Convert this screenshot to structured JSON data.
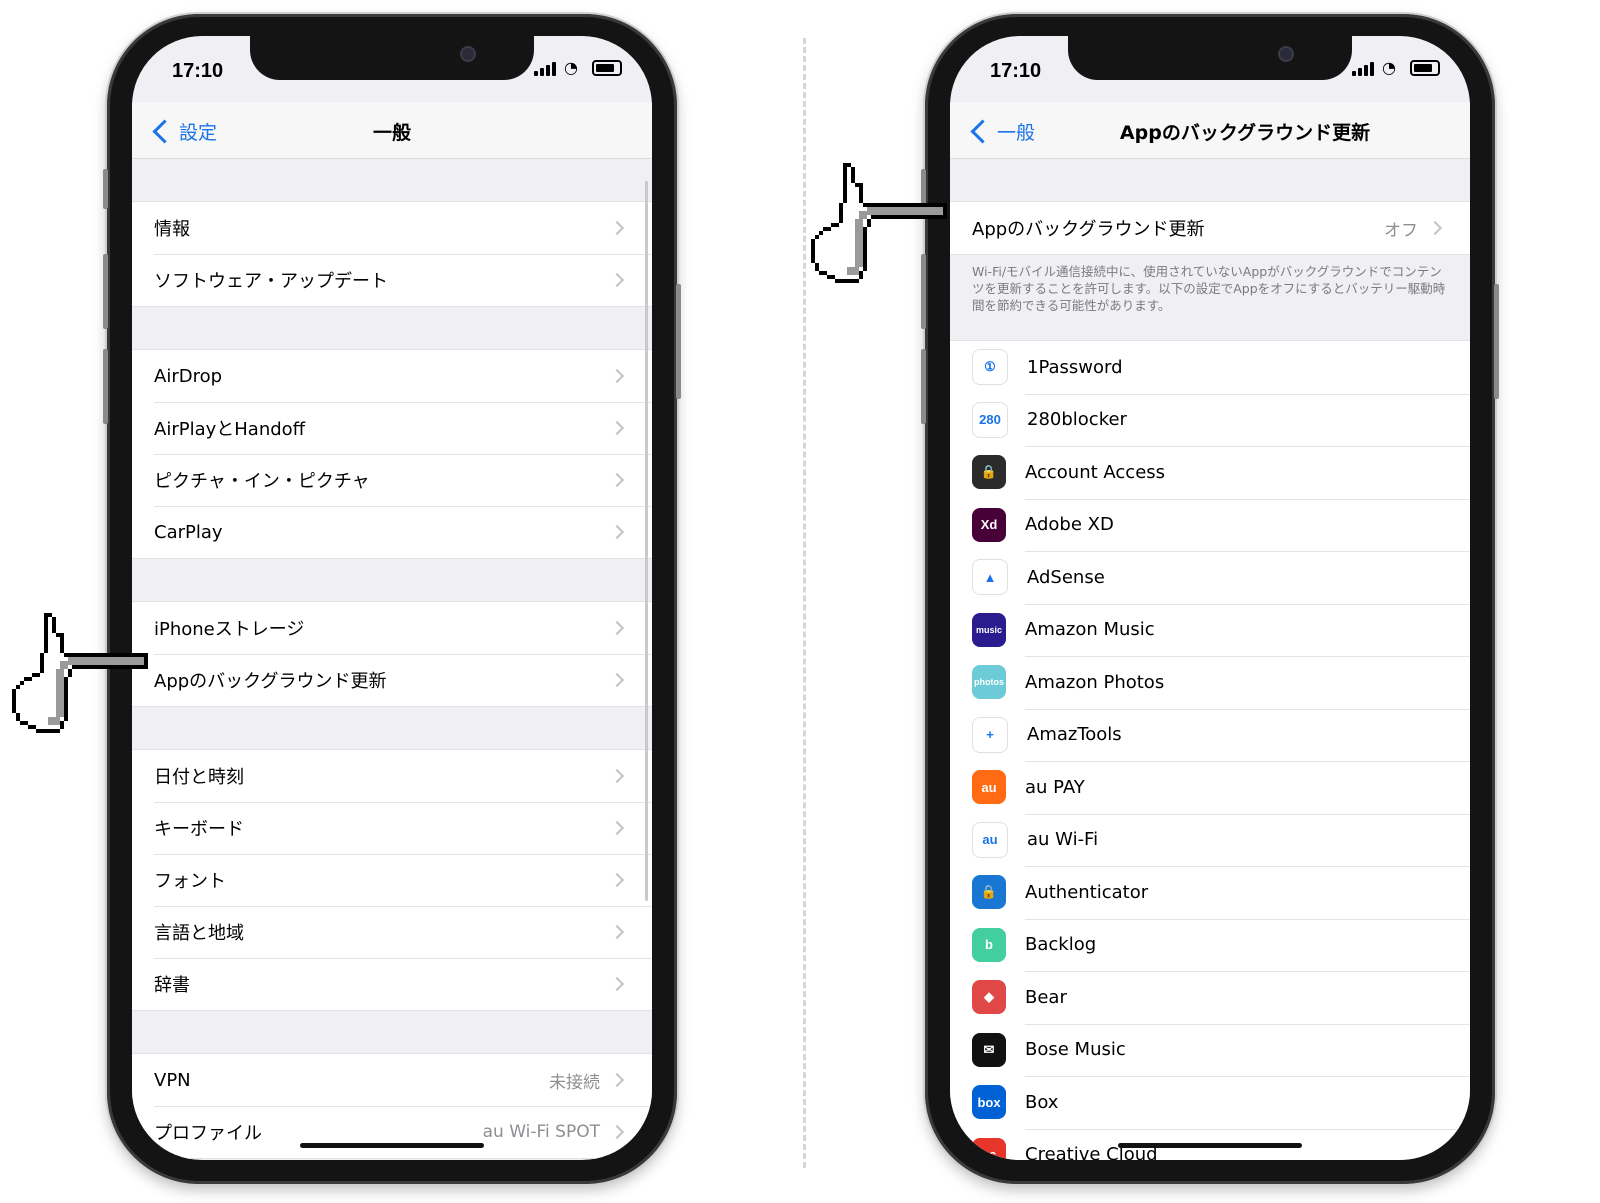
{
  "status": {
    "time": "17:10"
  },
  "left": {
    "back_label": "設定",
    "title": "一般",
    "groups": [
      [
        "情報",
        "ソフトウェア・アップデート"
      ],
      [
        "AirDrop",
        "AirPlayとHandoff",
        "ピクチャ・イン・ピクチャ",
        "CarPlay"
      ],
      [
        "iPhoneストレージ",
        "Appのバックグラウンド更新"
      ],
      [
        "日付と時刻",
        "キーボード",
        "フォント",
        "言語と地域",
        "辞書"
      ]
    ],
    "vpn": {
      "label": "VPN",
      "value": "未接続"
    },
    "profile": {
      "label": "プロファイル",
      "value": "au Wi-Fi SPOT"
    }
  },
  "right": {
    "back_label": "一般",
    "title": "Appのバックグラウンド更新",
    "toggle_row": {
      "label": "Appのバックグラウンド更新",
      "value": "オフ"
    },
    "footnote": "Wi-Fi/モバイル通信接続中に、使用されていないAppがバックグラウンドでコンテンツを更新することを許可します。以下の設定でAppをオフにするとバッテリー駆動時間を節約できる可能性があります。",
    "apps": [
      {
        "name": "1Password",
        "icon": "1password-icon",
        "color": "#ffffff",
        "glyph": "①"
      },
      {
        "name": "280blocker",
        "icon": "280blocker-icon",
        "color": "#ffffff",
        "glyph": "280"
      },
      {
        "name": "Account Access",
        "icon": "account-access-icon",
        "color": "#2b2b2b",
        "glyph": "🔒"
      },
      {
        "name": "Adobe XD",
        "icon": "adobe-xd-icon",
        "color": "#470137",
        "glyph": "Xd"
      },
      {
        "name": "AdSense",
        "icon": "adsense-icon",
        "color": "#ffffff",
        "glyph": "▲"
      },
      {
        "name": "Amazon Music",
        "icon": "amazon-music-icon",
        "color": "#2a1b8f",
        "glyph": "music"
      },
      {
        "name": "Amazon Photos",
        "icon": "amazon-photos-icon",
        "color": "#6ccbd6",
        "glyph": "photos"
      },
      {
        "name": "AmazTools",
        "icon": "amaztools-icon",
        "color": "#ffffff",
        "glyph": "+"
      },
      {
        "name": "au PAY",
        "icon": "au-pay-icon",
        "color": "#ff6a13",
        "glyph": "au"
      },
      {
        "name": "au Wi-Fi",
        "icon": "au-wifi-icon",
        "color": "#ffffff",
        "glyph": "au"
      },
      {
        "name": "Authenticator",
        "icon": "authenticator-icon",
        "color": "#1976d2",
        "glyph": "🔒"
      },
      {
        "name": "Backlog",
        "icon": "backlog-icon",
        "color": "#42ce9f",
        "glyph": "b"
      },
      {
        "name": "Bear",
        "icon": "bear-icon",
        "color": "#e04848",
        "glyph": "◆"
      },
      {
        "name": "Bose Music",
        "icon": "bose-music-icon",
        "color": "#111111",
        "glyph": "✉"
      },
      {
        "name": "Box",
        "icon": "box-icon",
        "color": "#0061d5",
        "glyph": "box"
      },
      {
        "name": "Creative Cloud",
        "icon": "creative-cloud-icon",
        "color": "#e8352b",
        "glyph": "cc"
      }
    ]
  }
}
